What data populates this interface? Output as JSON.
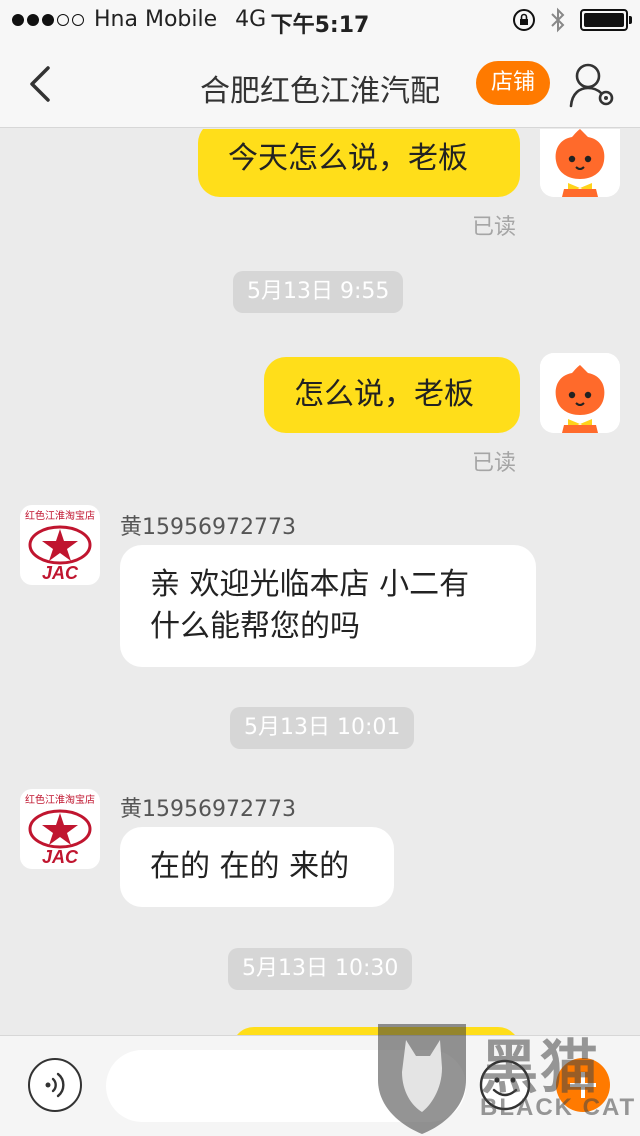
{
  "status_bar": {
    "carrier": "Hna Mobile",
    "network": "4G",
    "time": "下午5:17",
    "signal_bars_filled": 3,
    "signal_bars_total": 5
  },
  "nav": {
    "back_icon": "chevron-left-icon",
    "title": "合肥红色江淮汽配",
    "shop_button": "店铺",
    "user_settings_icon": "user-settings-icon"
  },
  "messages": {
    "m1": {
      "text": "今天怎么说，老板",
      "read": "已读"
    },
    "ts1": "5月13日 9:55",
    "m2": {
      "text": "怎么说，老板",
      "read": "已读"
    },
    "m3": {
      "sender": "黄15956972773",
      "line1": "亲 欢迎光临本店 小二有",
      "line2": "什么能帮您的吗",
      "avatar_caption": "红色江淮淘宝店",
      "avatar_brand": "JAC"
    },
    "ts2": "5月13日 10:01",
    "m4": {
      "sender": "黄15956972773",
      "text": "在的 在的 来的",
      "avatar_caption": "红色江淮淘宝店",
      "avatar_brand": "JAC"
    },
    "ts3": "5月13日 10:30"
  },
  "input_bar": {
    "placeholder": "",
    "voice_icon": "voice-icon",
    "emoji_icon": "emoji-icon",
    "plus_icon": "plus-icon"
  },
  "watermark": {
    "cn": "黑猫",
    "en": "BLACK CAT"
  },
  "colors": {
    "accent": "#ff7a00",
    "my_bubble": "#ffde1a",
    "brand_red": "#c0152f"
  }
}
